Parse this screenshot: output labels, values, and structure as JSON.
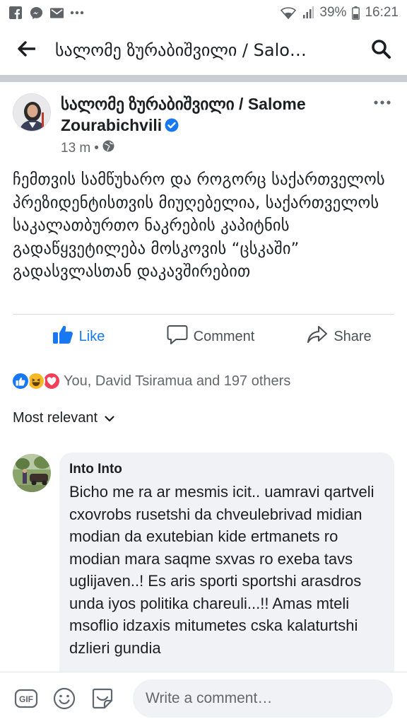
{
  "status_bar": {
    "battery_percent": "39%",
    "time": "16:21",
    "notification_icons": [
      "facebook-icon",
      "messenger-icon",
      "gmail-icon",
      "more-dots-icon"
    ],
    "system_icons": [
      "wifi-icon",
      "signal-icon",
      "battery-icon"
    ]
  },
  "header": {
    "title": "სალომე ზურაბიშვილი / Salo…",
    "back_icon": "back-arrow-icon",
    "search_icon": "search-icon"
  },
  "post": {
    "author": "სალომე ზურაბიშვილი / Salome Zourabichvili",
    "verified": true,
    "time": "13 m",
    "separator": "•",
    "audience_icon": "globe-icon",
    "text": "ჩემთვის სამწუხარო და როგორც საქართველოს პრეზიდენტისთვის მიუღებელია, საქართველოს საკალათბურთო ნაკრების კაპიტნის გადაწყვეტილება მოსკოვის “ცსკაში” გადასვლასთან დაკავშირებით",
    "actions": {
      "like": "Like",
      "comment": "Comment",
      "share": "Share"
    },
    "reactions_text": "You, David Tsiramua and 197 others",
    "sort_label": "Most relevant"
  },
  "comment": {
    "author": "Into Into",
    "text": "Bicho me ra ar mesmis icit.. uamravi qartveli cxovrobs rusetshi da chveulebrivad midian modian da exutebian kide ertmanets ro modian mara saqme sxvas ro exeba tavs uglijaven..! Es aris sporti  sportshi arasdros unda iyos  politika chareuli...!! Amas mteli msoflio idzaxis mitumetes cska kalaturtshi dzlieri gundia"
  },
  "composer": {
    "placeholder": "Write a comment…",
    "gif_label": "GIF"
  },
  "colors": {
    "accent": "#1877f2",
    "divider": "#cacdd2",
    "bubble": "#f0f2f5",
    "text": "#1c1e21",
    "muted": "#65676b"
  }
}
